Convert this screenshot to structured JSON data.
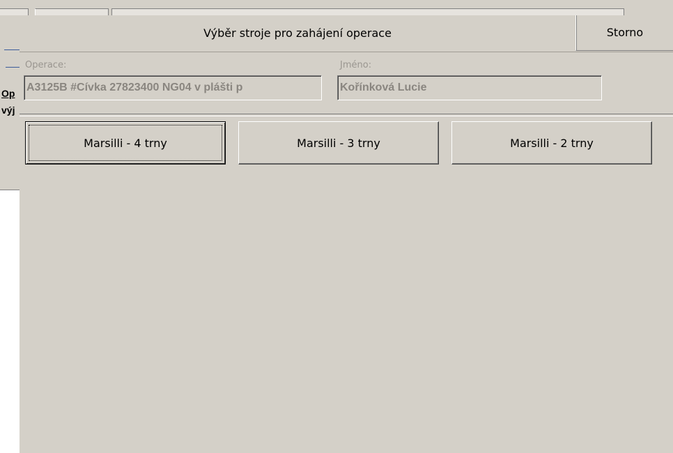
{
  "background_window": {
    "left_fragments": [
      "Op",
      "výj"
    ]
  },
  "dialog": {
    "title": "Výběr stroje pro zahájení operace",
    "cancel_label": "Storno",
    "fields": {
      "operation_label": "Operace:",
      "operation_value": "A3125B #Cívka 27823400 NG04 v plášti p",
      "name_label": "Jméno:",
      "name_value": "Kořínková Lucie"
    },
    "machines": [
      {
        "label": "Marsilli - 4 trny"
      },
      {
        "label": "Marsilli - 3 trny"
      },
      {
        "label": "Marsilli - 2 trny"
      }
    ]
  },
  "colors": {
    "dialog_bg": "#d4d0c8",
    "disabled_text": "#8a8680"
  }
}
